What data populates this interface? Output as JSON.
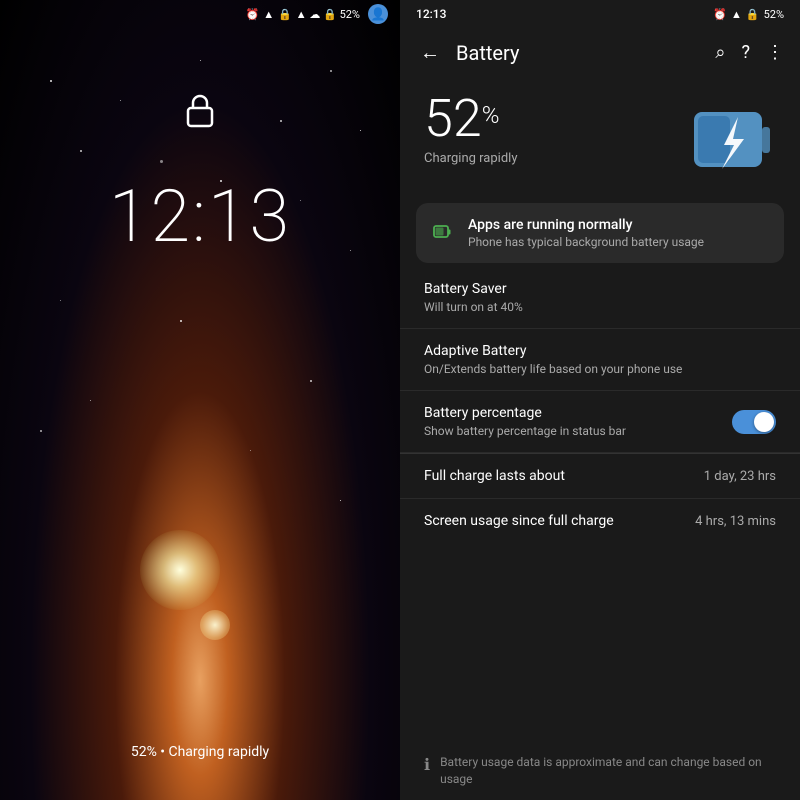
{
  "lockScreen": {
    "time": "12:13",
    "statusIcons": "▲ ☁ 🔒 52%",
    "bottomText": "52% • Charging rapidly",
    "avatar": "👤"
  },
  "batterySettings": {
    "statusBar": {
      "time": "12:13",
      "icons": "⏰ ▲ 🔒 52%"
    },
    "header": {
      "title": "Battery",
      "backLabel": "←",
      "searchLabel": "⌕",
      "helpLabel": "?",
      "menuLabel": "⋮"
    },
    "batteryLevel": "52",
    "batteryUnit": "%",
    "chargingStatus": "Charging rapidly",
    "appsCard": {
      "title": "Apps are running normally",
      "subtitle": "Phone has typical background battery usage"
    },
    "settingsItems": [
      {
        "title": "Battery Saver",
        "subtitle": "Will turn on at 40%",
        "value": "",
        "hasToggle": false
      },
      {
        "title": "Adaptive Battery",
        "subtitle": "On/Extends battery life based on your phone use",
        "value": "",
        "hasToggle": false
      },
      {
        "title": "Battery percentage",
        "subtitle": "Show battery percentage in status bar",
        "value": "",
        "hasToggle": true,
        "toggleOn": true
      }
    ],
    "infoItems": [
      {
        "label": "Full charge lasts about",
        "value": "1 day, 23 hrs"
      },
      {
        "label": "Screen usage since full charge",
        "value": "4 hrs, 13 mins"
      }
    ],
    "footerText": "Battery usage data is approximate and can change based on usage"
  }
}
